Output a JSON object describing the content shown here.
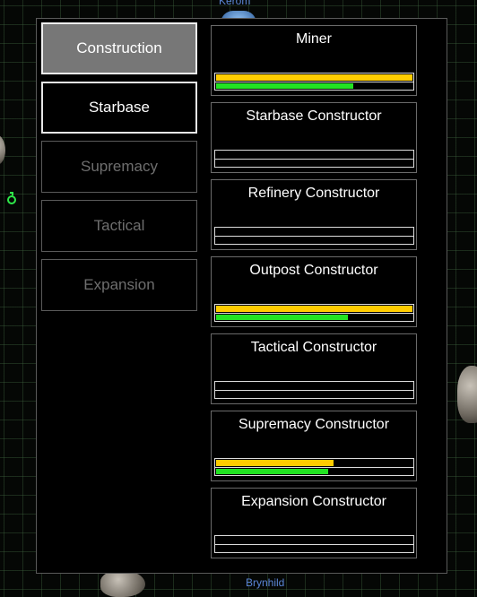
{
  "map": {
    "planet_label": "Kerom",
    "base_label": "Brynhild"
  },
  "categories": [
    {
      "label": "Construction",
      "state": "selected"
    },
    {
      "label": "Starbase",
      "state": "active"
    },
    {
      "label": "Supremacy",
      "state": "disabled"
    },
    {
      "label": "Tactical",
      "state": "disabled"
    },
    {
      "label": "Expansion",
      "state": "disabled"
    }
  ],
  "items": [
    {
      "title": "Miner",
      "progress_yellow": 1.0,
      "progress_green": 0.7
    },
    {
      "title": "Starbase Constructor",
      "progress_yellow": 0.0,
      "progress_green": 0.0
    },
    {
      "title": "Refinery Constructor",
      "progress_yellow": 0.0,
      "progress_green": 0.0
    },
    {
      "title": "Outpost Constructor",
      "progress_yellow": 1.0,
      "progress_green": 0.67
    },
    {
      "title": "Tactical Constructor",
      "progress_yellow": 0.0,
      "progress_green": 0.0
    },
    {
      "title": "Supremacy Constructor",
      "progress_yellow": 0.6,
      "progress_green": 0.57
    },
    {
      "title": "Expansion Constructor",
      "progress_yellow": 0.0,
      "progress_green": 0.0
    }
  ],
  "colors": {
    "progress_primary": "#ffcc00",
    "progress_secondary": "#22e322",
    "selected_button_bg": "#777777"
  }
}
